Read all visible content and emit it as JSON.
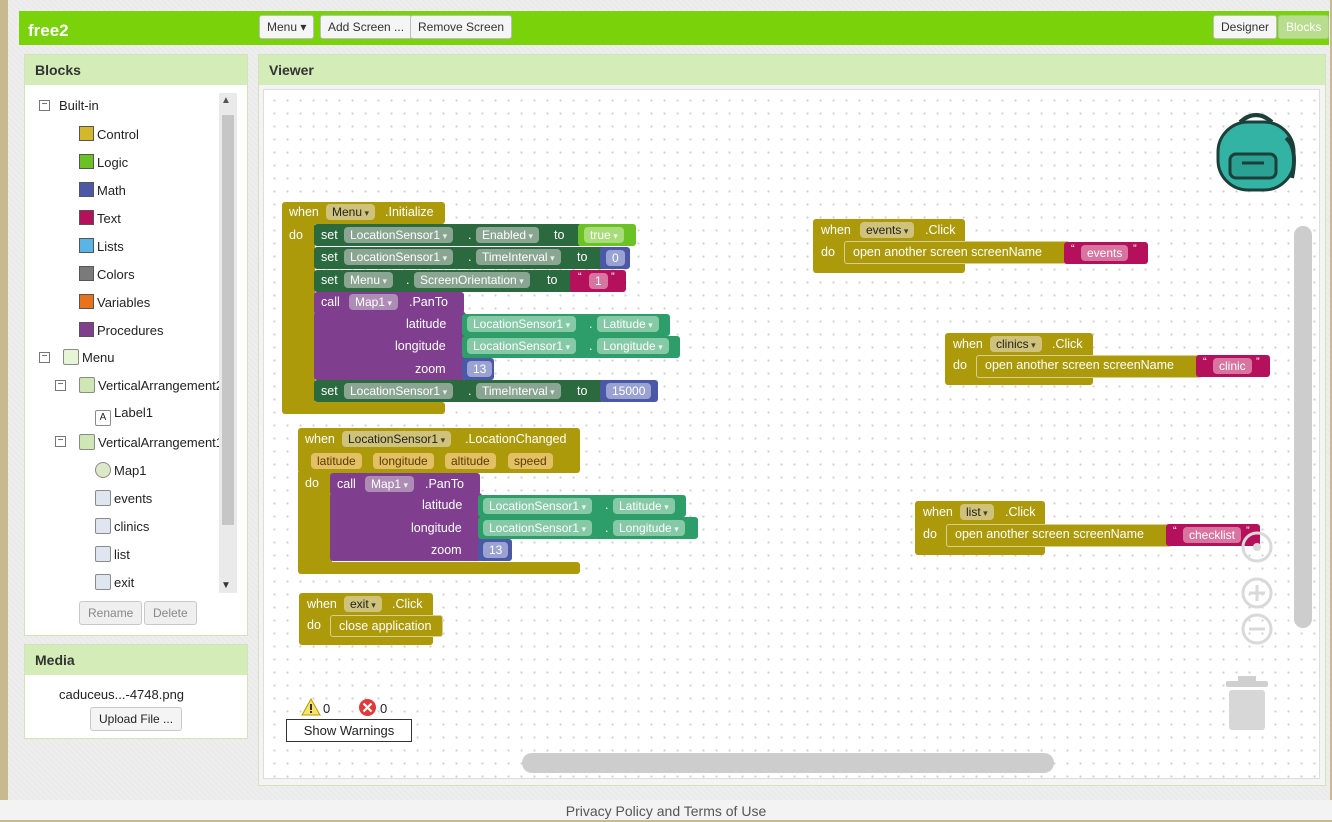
{
  "app": {
    "title": "free2"
  },
  "toolbar": {
    "menu_label": "Menu ▾",
    "add_screen_label": "Add Screen ...",
    "remove_screen_label": "Remove Screen",
    "designer_label": "Designer",
    "blocks_label": "Blocks"
  },
  "blocks_panel": {
    "title": "Blocks",
    "builtin_label": "Built-in",
    "builtin_items": [
      {
        "label": "Control",
        "color": "#d2b82a"
      },
      {
        "label": "Logic",
        "color": "#6bc224"
      },
      {
        "label": "Math",
        "color": "#4b58a6"
      },
      {
        "label": "Text",
        "color": "#b5105b"
      },
      {
        "label": "Lists",
        "color": "#5ab4e6"
      },
      {
        "label": "Colors",
        "color": "#7a7a7a"
      },
      {
        "label": "Variables",
        "color": "#e8731a"
      },
      {
        "label": "Procedures",
        "color": "#7f3f8e"
      }
    ],
    "screen_label": "Menu",
    "components": {
      "va2": "VerticalArrangement2",
      "label1": "Label1",
      "va1": "VerticalArrangement1",
      "map1": "Map1",
      "events": "events",
      "clinics": "clinics",
      "list": "list",
      "exit": "exit"
    },
    "rename_label": "Rename",
    "delete_label": "Delete"
  },
  "media_panel": {
    "title": "Media",
    "file_name": "caduceus...-4748.png",
    "upload_label": "Upload File ..."
  },
  "viewer": {
    "title": "Viewer"
  },
  "workspace": {
    "kw_when": "when",
    "kw_do": "do",
    "kw_set": "set",
    "kw_to": "to",
    "kw_call": "call",
    "dot": ".",
    "menu_init": {
      "component": "Menu",
      "event": ".Initialize"
    },
    "set1": {
      "component": "LocationSensor1",
      "property": "Enabled",
      "value": "true"
    },
    "set2": {
      "component": "LocationSensor1",
      "property": "TimeInterval",
      "value": "0"
    },
    "set3": {
      "component": "Menu",
      "property": "ScreenOrientation",
      "value": "1"
    },
    "pan1": {
      "component": "Map1",
      "method": ".PanTo",
      "lat_label": "latitude",
      "lon_label": "longitude",
      "zoom_label": "zoom",
      "lat_comp": "LocationSensor1",
      "lat_prop": "Latitude",
      "lon_comp": "LocationSensor1",
      "lon_prop": "Longitude",
      "zoom": "13"
    },
    "set4": {
      "component": "LocationSensor1",
      "property": "TimeInterval",
      "value": "15000"
    },
    "loc_changed": {
      "component": "LocationSensor1",
      "event": ".LocationChanged",
      "params": [
        "latitude",
        "longitude",
        "altitude",
        "speed"
      ]
    },
    "pan2": {
      "component": "Map1",
      "method": ".PanTo",
      "lat_label": "latitude",
      "lon_label": "longitude",
      "zoom_label": "zoom",
      "lat_comp": "LocationSensor1",
      "lat_prop": "Latitude",
      "lon_comp": "LocationSensor1",
      "lon_prop": "Longitude",
      "zoom": "13"
    },
    "exit_click": {
      "component": "exit",
      "event": ".Click",
      "action": "close application"
    },
    "events_click": {
      "component": "events",
      "event": ".Click",
      "action": "open another screen  screenName",
      "value": "events"
    },
    "clinics_click": {
      "component": "clinics",
      "event": ".Click",
      "action": "open another screen  screenName",
      "value": "clinic"
    },
    "list_click": {
      "component": "list",
      "event": ".Click",
      "action": "open another screen  screenName",
      "value": "checklist"
    },
    "warnings_count": "0",
    "errors_count": "0",
    "show_warnings_label": "Show Warnings"
  },
  "footer": {
    "text": "Privacy Policy and Terms of Use"
  }
}
